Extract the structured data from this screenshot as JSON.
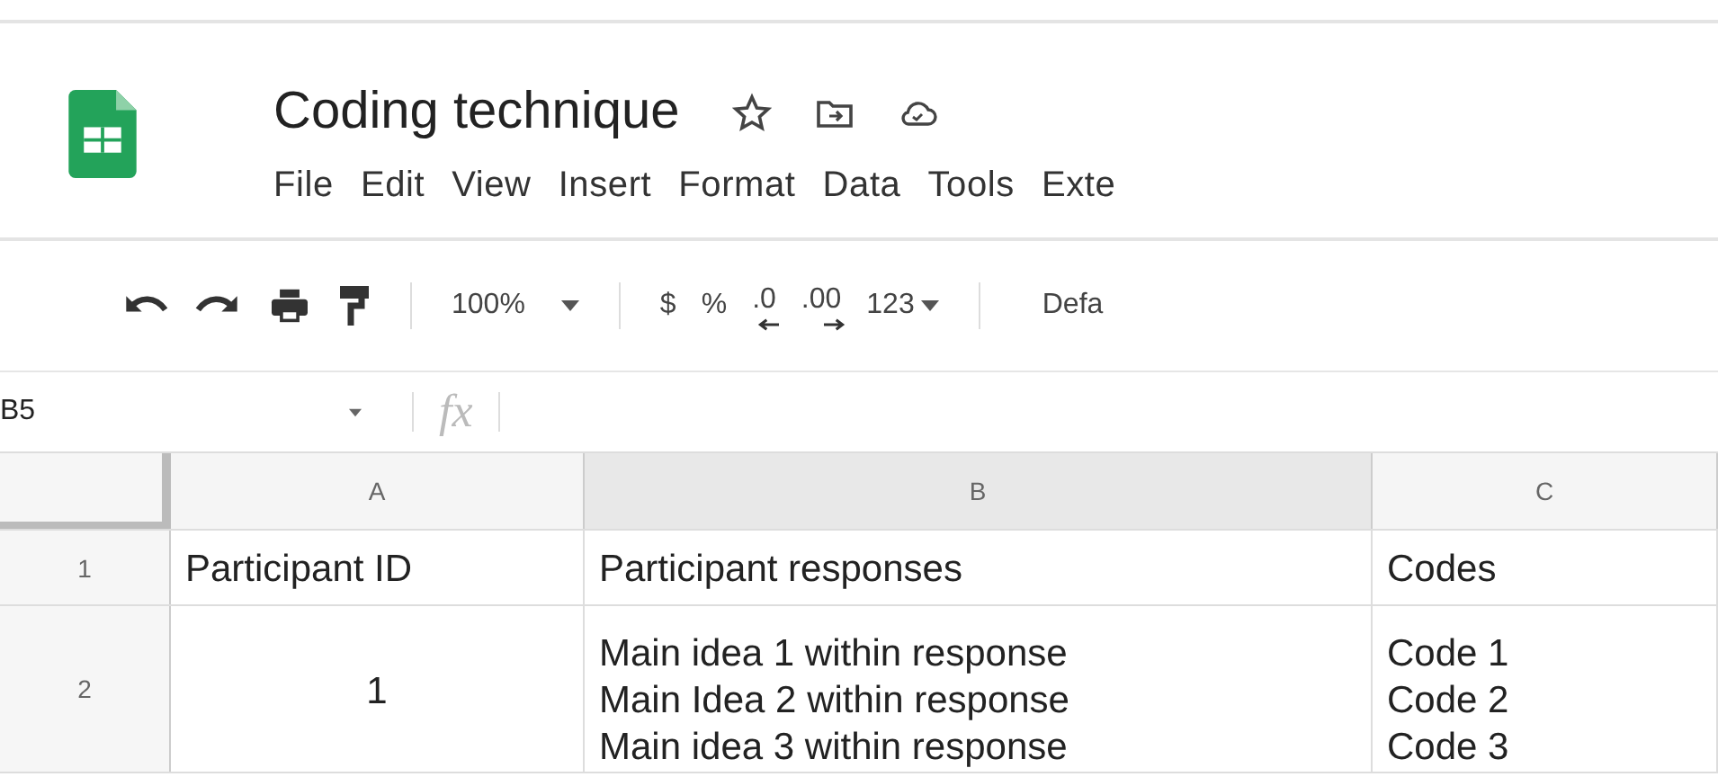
{
  "document": {
    "title": "Coding technique"
  },
  "menu": [
    "File",
    "Edit",
    "View",
    "Insert",
    "Format",
    "Data",
    "Tools",
    "Exte"
  ],
  "toolbar": {
    "zoom": "100%",
    "currency": "$",
    "percent": "%",
    "decrease_decimals": ".0",
    "increase_decimals": ".00",
    "more_formats": "123",
    "font": "Defa"
  },
  "formula_bar": {
    "cell_reference": "B5",
    "function_label": "fx"
  },
  "columns": [
    "A",
    "B",
    "C"
  ],
  "rows": [
    {
      "number": "1",
      "cells": [
        [
          "Participant ID"
        ],
        [
          "Participant responses"
        ],
        [
          "Codes"
        ]
      ]
    },
    {
      "number": "2",
      "cells": [
        [
          "1"
        ],
        [
          "Main idea 1 within response",
          "Main Idea 2 within response",
          "Main idea 3 within response"
        ],
        [
          "Code 1",
          "Code 2",
          "Code 3"
        ]
      ]
    }
  ]
}
